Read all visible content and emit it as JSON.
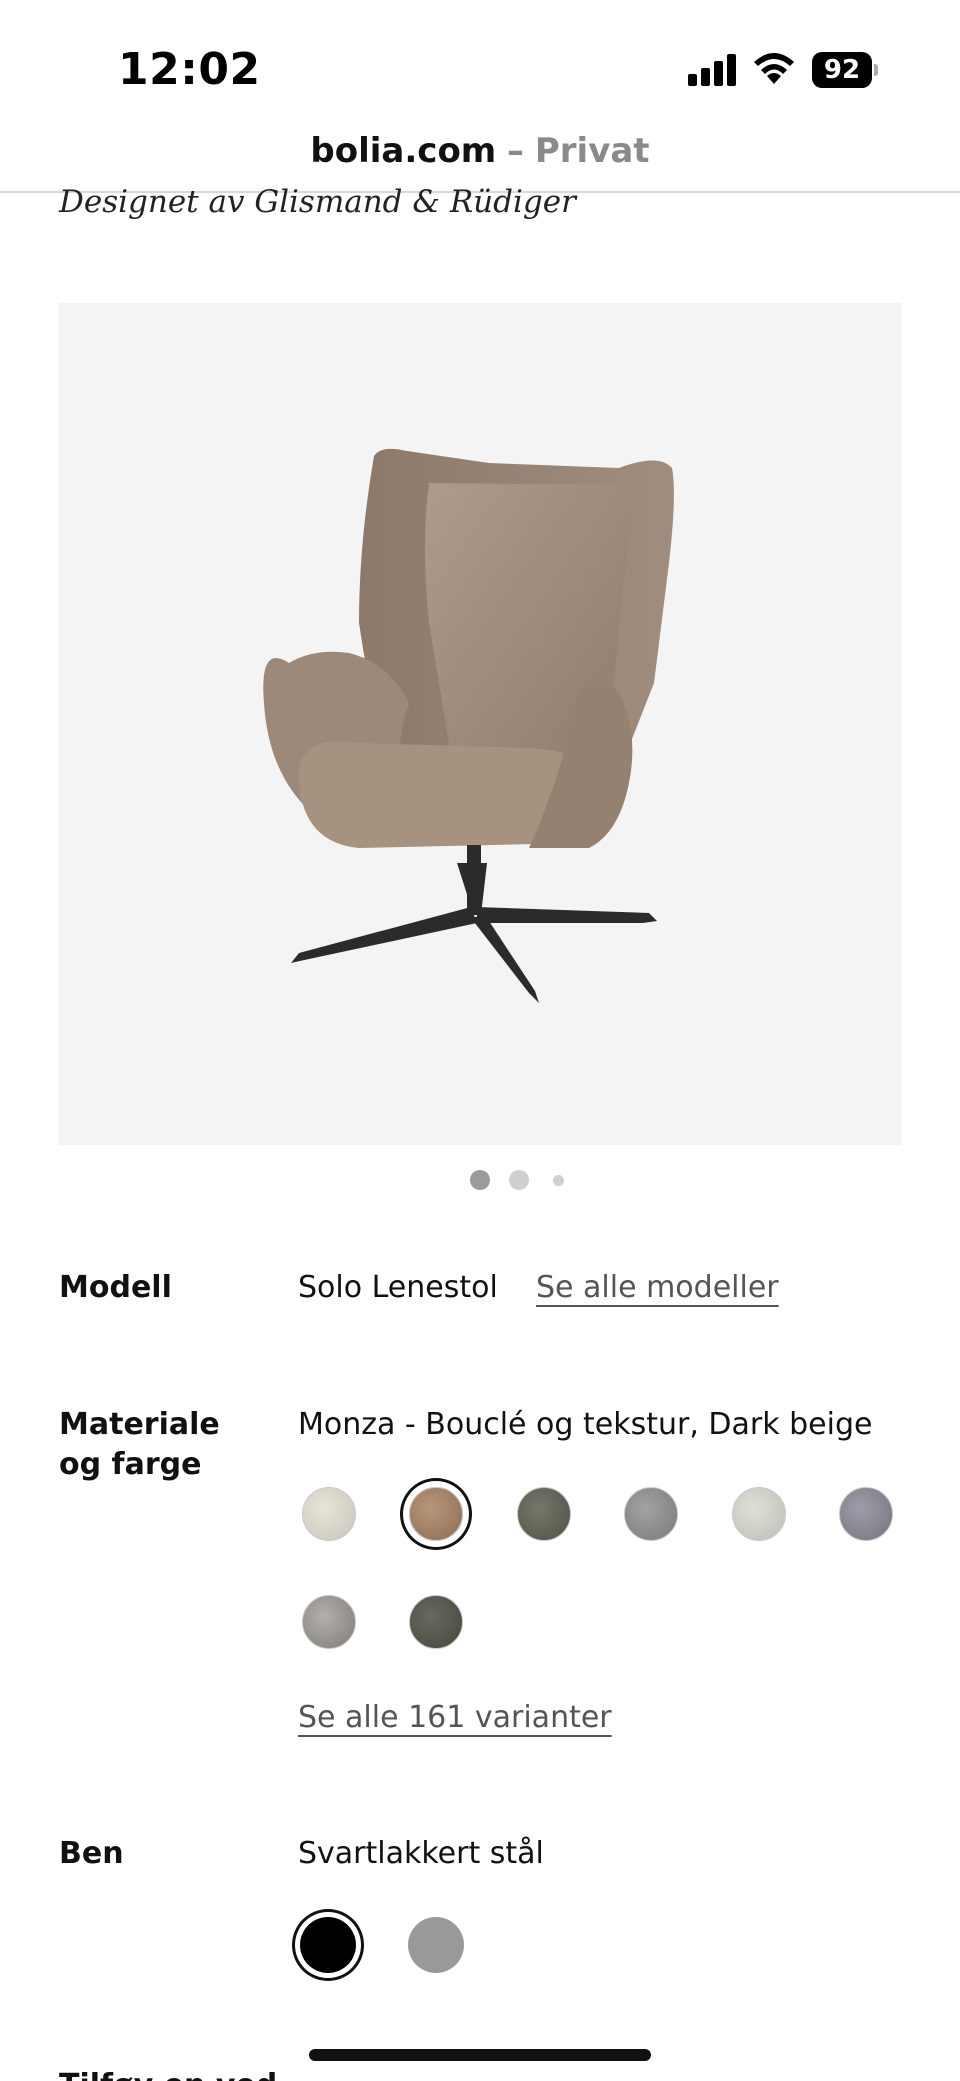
{
  "status_bar": {
    "time": "12:02",
    "battery": "92",
    "icons": [
      "signal-icon",
      "wifi-icon",
      "battery-icon"
    ]
  },
  "url_bar": {
    "domain": "bolia.com",
    "separator": "–",
    "mode": "Privat"
  },
  "product": {
    "designer": "Designet av Glismand & Rüdiger",
    "image": {
      "name": "solo-armchair-image",
      "background": "#f4f4f4",
      "fabric_color": "#a89484",
      "leg_color": "#2b2b2b"
    },
    "carousel": {
      "count": 3,
      "active_index": 0
    }
  },
  "options": {
    "model": {
      "label": "Modell",
      "value": "Solo Lenestol",
      "link": "Se alle modeller"
    },
    "material": {
      "label_line1": "Materiale",
      "label_line2": "og farge",
      "value": "Monza - Bouclé og tekstur, Dark beige",
      "swatches": [
        {
          "color": "#d8d4ca",
          "selected": false
        },
        {
          "color": "#a07f63",
          "selected": true
        },
        {
          "color": "#5e6257",
          "selected": false
        },
        {
          "color": "#8c8c8c",
          "selected": false
        },
        {
          "color": "#cfd1c9",
          "selected": false
        },
        {
          "color": "#8a8792",
          "selected": false
        },
        {
          "color": "#9a9693",
          "selected": false
        },
        {
          "color": "#55574d",
          "selected": false
        }
      ],
      "link": "Se alle 161 varianter"
    },
    "legs": {
      "label": "Ben",
      "value": "Svartlakkert stål",
      "swatches": [
        {
          "color": "#000000",
          "selected": true
        },
        {
          "color": "#999999",
          "selected": false
        }
      ]
    },
    "next_section_partial": "Tilføy en ved"
  }
}
